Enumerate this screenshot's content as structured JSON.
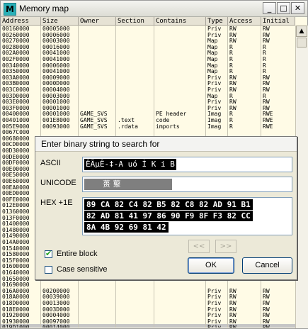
{
  "window": {
    "title": "Memory map",
    "app_icon": "M",
    "min": "_",
    "max": "□",
    "close": "✕"
  },
  "columns": [
    "Address",
    "Size",
    "Owner",
    "Section",
    "Contains",
    "Type",
    "Access",
    "Initial"
  ],
  "rows": [
    [
      "00160000",
      "00005000",
      "",
      "",
      "",
      "Priv",
      "RW",
      "RW"
    ],
    [
      "00260000",
      "00006000",
      "",
      "",
      "",
      "Priv",
      "RW",
      "RW"
    ],
    [
      "00270000",
      "00003000",
      "",
      "",
      "",
      "Map",
      "RW",
      "RW"
    ],
    [
      "00280000",
      "00016000",
      "",
      "",
      "",
      "Map",
      "R",
      "R"
    ],
    [
      "002A0000",
      "00041000",
      "",
      "",
      "",
      "Map",
      "R",
      "R"
    ],
    [
      "002F0000",
      "00041000",
      "",
      "",
      "",
      "Map",
      "R",
      "R"
    ],
    [
      "00340000",
      "00006000",
      "",
      "",
      "",
      "Map",
      "R",
      "R"
    ],
    [
      "00350000",
      "00041000",
      "",
      "",
      "",
      "Map",
      "R",
      "R"
    ],
    [
      "003A0000",
      "00009000",
      "",
      "",
      "",
      "Priv",
      "RW",
      "RW"
    ],
    [
      "003B0000",
      "0000D000",
      "",
      "",
      "",
      "Priv",
      "RW",
      "RW"
    ],
    [
      "003C0000",
      "00004000",
      "",
      "",
      "",
      "Priv",
      "RW",
      "RW"
    ],
    [
      "003D0000",
      "00003000",
      "",
      "",
      "",
      "Map",
      "R",
      "R"
    ],
    [
      "003E0000",
      "00001000",
      "",
      "",
      "",
      "Priv",
      "RW",
      "RW"
    ],
    [
      "003F0000",
      "00001000",
      "",
      "",
      "",
      "Priv",
      "RW",
      "RW"
    ],
    [
      "00400000",
      "00001000",
      "GAME_SVS",
      "",
      "PE header",
      "Imag",
      "R",
      "RWE"
    ],
    [
      "00401000",
      "001E8000",
      "GAME_SVS",
      ".text",
      "code",
      "Imag",
      "R",
      "RWE"
    ],
    [
      "005E9000",
      "00093000",
      "GAME_SVS",
      ".rdata",
      "imports",
      "Imag",
      "R",
      "RWE"
    ],
    [
      "0067C000",
      "",
      "",
      "",
      "",
      "",
      "",
      ""
    ],
    [
      "00680000",
      "",
      "",
      "",
      "",
      "",
      "",
      ""
    ],
    [
      "00CD0000",
      "",
      "",
      "",
      "",
      "",
      "",
      ""
    ],
    [
      "00D30000",
      "",
      "",
      "",
      "",
      "",
      "",
      ""
    ],
    [
      "00DE0000",
      "",
      "",
      "",
      "",
      "",
      "",
      ""
    ],
    [
      "00DF0000",
      "",
      "",
      "",
      "",
      "",
      "",
      ""
    ],
    [
      "00E00000",
      "",
      "",
      "",
      "",
      "",
      "",
      ""
    ],
    [
      "00E50000",
      "",
      "",
      "",
      "",
      "",
      "",
      ""
    ],
    [
      "00E60000",
      "",
      "",
      "",
      "",
      "",
      "",
      ""
    ],
    [
      "00EA0000",
      "",
      "",
      "",
      "",
      "",
      "",
      ""
    ],
    [
      "00ED0000",
      "",
      "",
      "",
      "",
      "",
      "",
      ""
    ],
    [
      "00FE0000",
      "",
      "",
      "",
      "",
      "",
      "",
      ""
    ],
    [
      "012E0000",
      "",
      "",
      "",
      "",
      "",
      "",
      ""
    ],
    [
      "01360000",
      "",
      "",
      "",
      "",
      "",
      "",
      ""
    ],
    [
      "013F0000",
      "",
      "",
      "",
      "",
      "",
      "",
      ""
    ],
    [
      "01400000",
      "",
      "",
      "",
      "",
      "",
      "",
      ""
    ],
    [
      "01480000",
      "",
      "",
      "",
      "",
      "",
      "",
      ""
    ],
    [
      "01490000",
      "",
      "",
      "",
      "",
      "",
      "",
      ""
    ],
    [
      "014A0000",
      "",
      "",
      "",
      "",
      "",
      "",
      ""
    ],
    [
      "01540000",
      "",
      "",
      "",
      "",
      "",
      "",
      ""
    ],
    [
      "01580000",
      "",
      "",
      "",
      "",
      "",
      "",
      ""
    ],
    [
      "015F0000",
      "",
      "",
      "",
      "",
      "",
      "",
      ""
    ],
    [
      "01600000",
      "",
      "",
      "",
      "",
      "",
      "",
      ""
    ],
    [
      "01640000",
      "",
      "",
      "",
      "",
      "",
      "",
      ""
    ],
    [
      "01650000",
      "",
      "",
      "",
      "",
      "",
      "",
      ""
    ],
    [
      "01690000",
      "",
      "",
      "",
      "",
      "",
      "",
      ""
    ],
    [
      "016A0000",
      "00200000",
      "",
      "",
      "",
      "Priv",
      "RW",
      "RW"
    ],
    [
      "018A0000",
      "00039000",
      "",
      "",
      "",
      "Priv",
      "RW",
      "RW"
    ],
    [
      "018D0000",
      "00013000",
      "",
      "",
      "",
      "Priv",
      "RW",
      "RW"
    ],
    [
      "018E0000",
      "0003D000",
      "",
      "",
      "",
      "Priv",
      "RW",
      "RW"
    ],
    [
      "01920000",
      "00004000",
      "",
      "",
      "",
      "Priv",
      "RW",
      "RW"
    ],
    [
      "01930000",
      "00097000",
      "",
      "",
      "",
      "Priv",
      "RW",
      "RW"
    ],
    [
      "019D1000",
      "00014000",
      "",
      "",
      "",
      "Priv",
      "RW",
      "RW"
    ]
  ],
  "selected_row": 49,
  "dialog": {
    "title": "Enter binary string to search for",
    "ascii_label": "ASCII",
    "ascii_value": "ÊÃµÊ-‡-A uó Ì K i B",
    "unicode_label": "UNICODE",
    "unicode_value": "蒉  藂",
    "hex_label": "HEX +1E",
    "hex_lines": [
      "89 CA 82 C4 82 B5 82 C8 82 AD 91 B1",
      "82 AD 81 41 97 86 90 F9 8F F3 82 CC",
      "8A 4B 92 69 81 42"
    ],
    "prev_label": "<<",
    "next_label": ">>",
    "entire_block_label": "Entire block",
    "entire_block_checked": true,
    "case_sensitive_label": "Case sensitive",
    "case_sensitive_checked": false,
    "ok_label": "OK",
    "cancel_label": "Cancel"
  }
}
